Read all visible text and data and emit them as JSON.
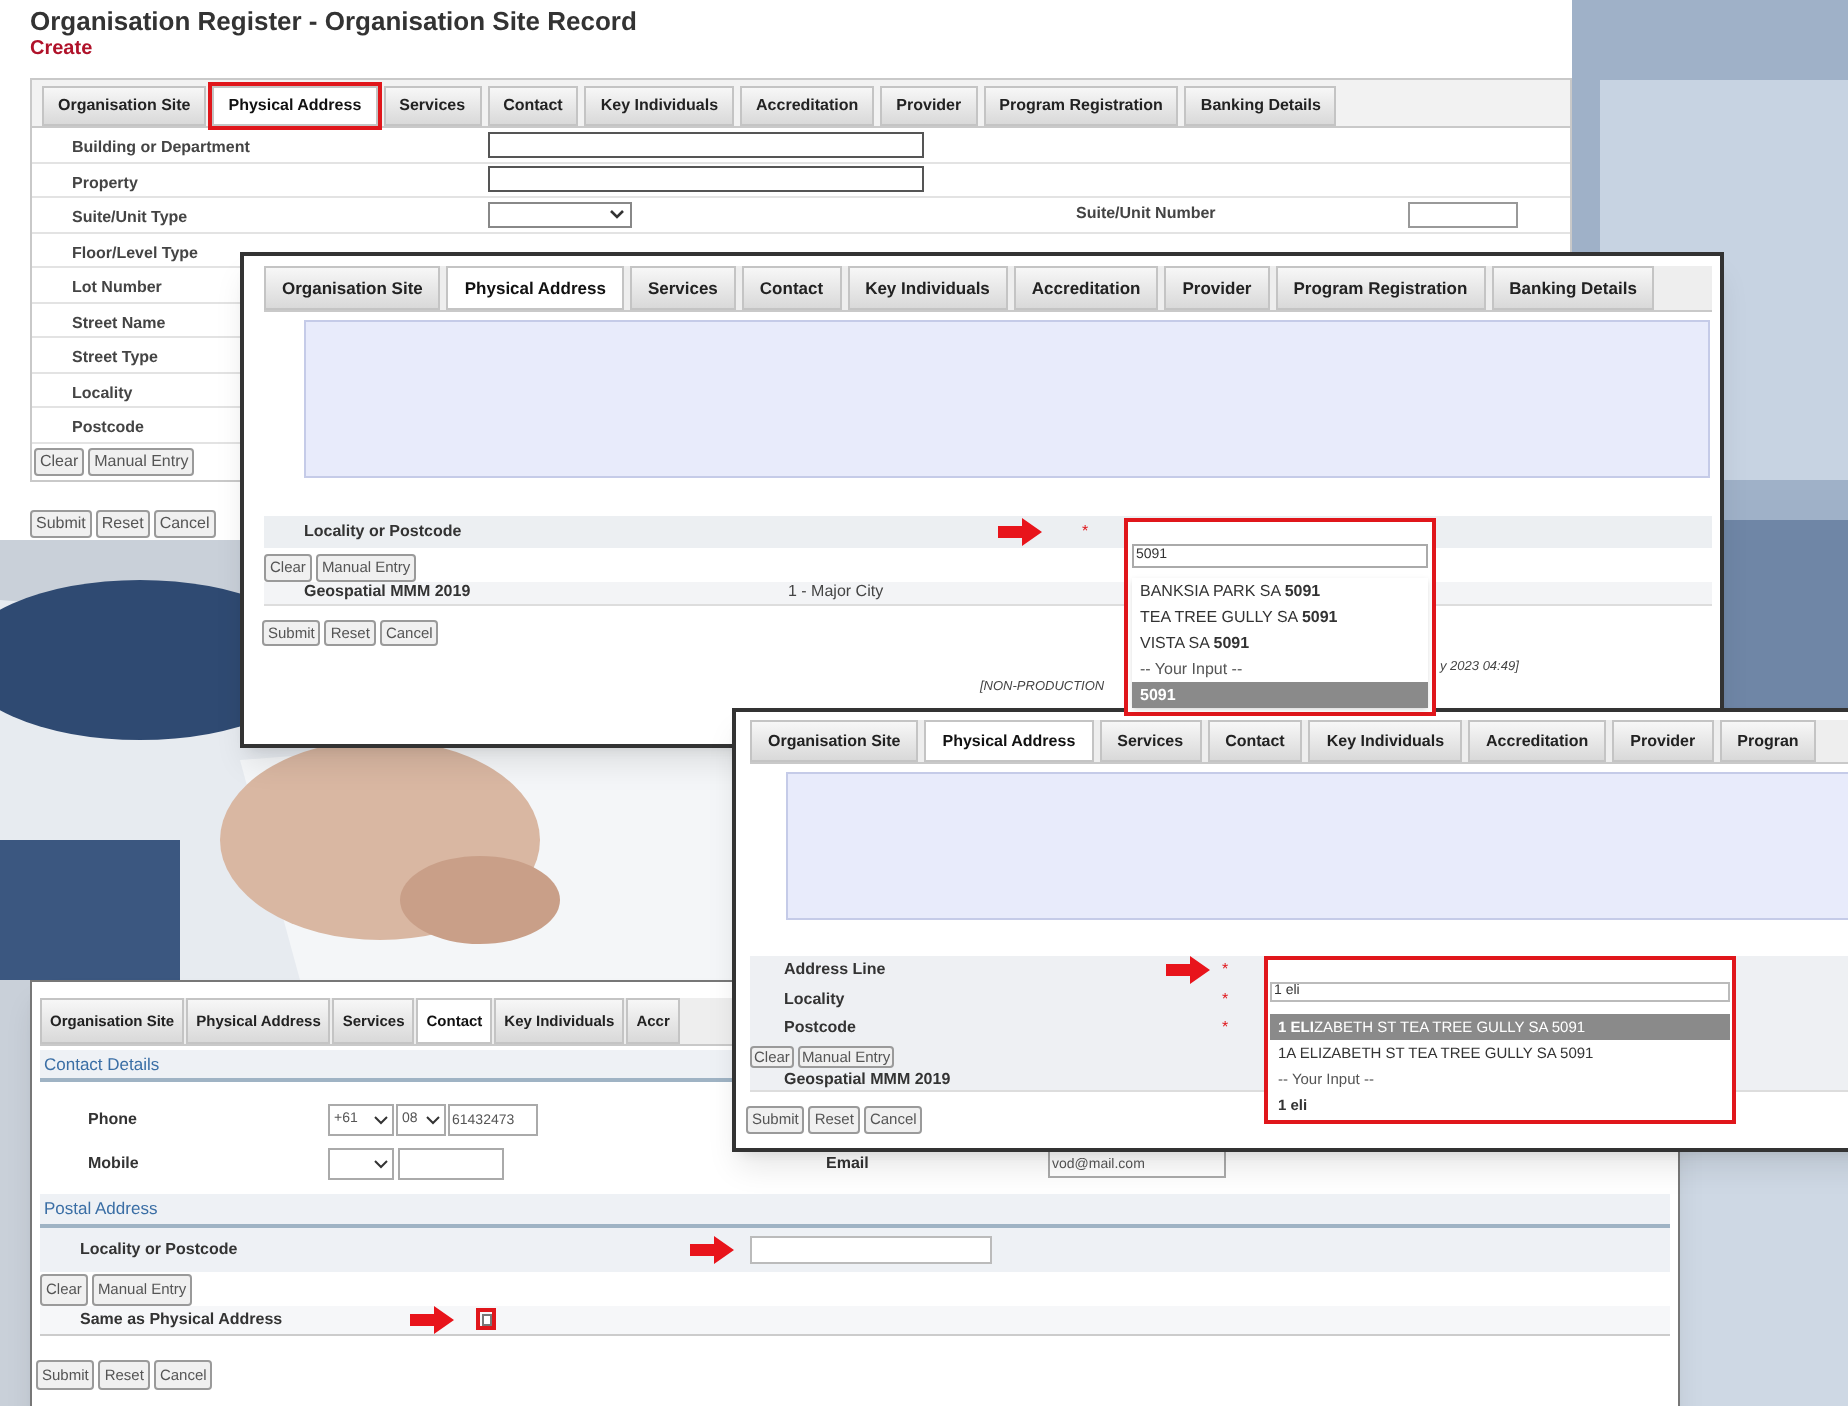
{
  "page": {
    "title": "Organisation Register - Organisation Site Record",
    "mode": "Create"
  },
  "base_form": {
    "tabs": [
      {
        "label": "Organisation Site",
        "selected": false,
        "highlighted": false
      },
      {
        "label": "Physical Address",
        "selected": true,
        "highlighted": true
      },
      {
        "label": "Services",
        "selected": false,
        "highlighted": false
      },
      {
        "label": "Contact",
        "selected": false,
        "highlighted": false
      },
      {
        "label": "Key Individuals",
        "selected": false,
        "highlighted": false
      },
      {
        "label": "Accreditation",
        "selected": false,
        "highlighted": false
      },
      {
        "label": "Provider",
        "selected": false,
        "highlighted": false
      },
      {
        "label": "Program Registration",
        "selected": false,
        "highlighted": false
      },
      {
        "label": "Banking Details",
        "selected": false,
        "highlighted": false
      }
    ],
    "fields": [
      {
        "label": "Building or Department",
        "kind": "text"
      },
      {
        "label": "Property",
        "kind": "text"
      },
      {
        "label": "Suite/Unit Type",
        "kind": "select",
        "side_label": "Suite/Unit Number"
      },
      {
        "label": "Floor/Level Type",
        "kind": "label"
      },
      {
        "label": "Lot Number",
        "kind": "label"
      },
      {
        "label": "Street Name",
        "kind": "label"
      },
      {
        "label": "Street Type",
        "kind": "label"
      },
      {
        "label": "Locality",
        "kind": "label"
      },
      {
        "label": "Postcode",
        "kind": "label"
      }
    ],
    "address_buttons": [
      "Clear",
      "Manual Entry"
    ],
    "form_buttons": [
      "Submit",
      "Reset",
      "Cancel"
    ]
  },
  "locality_window": {
    "tabs": [
      {
        "label": "Organisation Site",
        "selected": false
      },
      {
        "label": "Physical Address",
        "selected": true
      },
      {
        "label": "Services",
        "selected": false
      },
      {
        "label": "Contact",
        "selected": false
      },
      {
        "label": "Key Individuals",
        "selected": false
      },
      {
        "label": "Accreditation",
        "selected": false
      },
      {
        "label": "Provider",
        "selected": false
      },
      {
        "label": "Program Registration",
        "selected": false
      },
      {
        "label": "Banking Details",
        "selected": false
      }
    ],
    "field": {
      "label": "Locality or Postcode",
      "required": "*",
      "value": "5091"
    },
    "suggestions": [
      {
        "text": "BANKSIA PARK SA **5091**",
        "kind": "option",
        "selected": false
      },
      {
        "text": "TEA TREE GULLY SA **5091**",
        "kind": "option",
        "selected": false
      },
      {
        "text": "VISTA SA **5091**",
        "kind": "option",
        "selected": false
      },
      {
        "text": "-- Your Input --",
        "kind": "header"
      },
      {
        "text": "5091",
        "kind": "input",
        "selected": true
      }
    ],
    "address_buttons": [
      "Clear",
      "Manual Entry"
    ],
    "geospatial": {
      "label": "Geospatial MMM 2019",
      "value": "1 - Major City"
    },
    "form_buttons": [
      "Submit",
      "Reset",
      "Cancel"
    ],
    "footer": [
      "[NON-PRODUCTION",
      "y 2023 04:49]"
    ]
  },
  "address_window": {
    "tabs": [
      {
        "label": "Organisation Site",
        "selected": false
      },
      {
        "label": "Physical Address",
        "selected": true
      },
      {
        "label": "Services",
        "selected": false
      },
      {
        "label": "Contact",
        "selected": false
      },
      {
        "label": "Key Individuals",
        "selected": false
      },
      {
        "label": "Accreditation",
        "selected": false
      },
      {
        "label": "Provider",
        "selected": false
      },
      {
        "label": "Progran",
        "selected": false
      }
    ],
    "fields": [
      {
        "label": "Address Line",
        "required": "*",
        "value": "1 eli"
      },
      {
        "label": "Locality",
        "required": "*"
      },
      {
        "label": "Postcode",
        "required": "*"
      }
    ],
    "suggestions": [
      {
        "text": "**1 ELI**ZABETH ST TEA TREE GULLY SA 5091",
        "kind": "option",
        "selected": true
      },
      {
        "text": "1A ELIZABETH ST TEA TREE GULLY SA 5091",
        "kind": "option",
        "selected": false
      },
      {
        "text": "-- Your Input --",
        "kind": "header"
      },
      {
        "text": "1 eli",
        "kind": "input",
        "selected": false
      }
    ],
    "address_buttons": [
      "Clear",
      "Manual Entry"
    ],
    "geospatial": {
      "label": "Geospatial MMM 2019"
    },
    "form_buttons": [
      "Submit",
      "Reset",
      "Cancel"
    ]
  },
  "contact_window": {
    "tabs": [
      {
        "label": "Organisation Site",
        "selected": false
      },
      {
        "label": "Physical Address",
        "selected": false
      },
      {
        "label": "Services",
        "selected": false
      },
      {
        "label": "Contact",
        "selected": true
      },
      {
        "label": "Key Individuals",
        "selected": false
      },
      {
        "label": "Accr",
        "selected": false
      }
    ],
    "contact_details": {
      "title": "Contact Details",
      "phone": {
        "label": "Phone",
        "country": "+61",
        "area": "08",
        "number": "61432473"
      },
      "mobile": {
        "label": "Mobile"
      },
      "email": {
        "label": "Email",
        "value": "vod@mail.com"
      }
    },
    "postal_address": {
      "title": "Postal Address",
      "locality": {
        "label": "Locality or Postcode"
      },
      "address_buttons": [
        "Clear",
        "Manual Entry"
      ],
      "same_as_physical": {
        "label": "Same as Physical Address",
        "checked": false,
        "highlighted": true
      }
    },
    "form_buttons": [
      "Submit",
      "Reset",
      "Cancel"
    ]
  }
}
